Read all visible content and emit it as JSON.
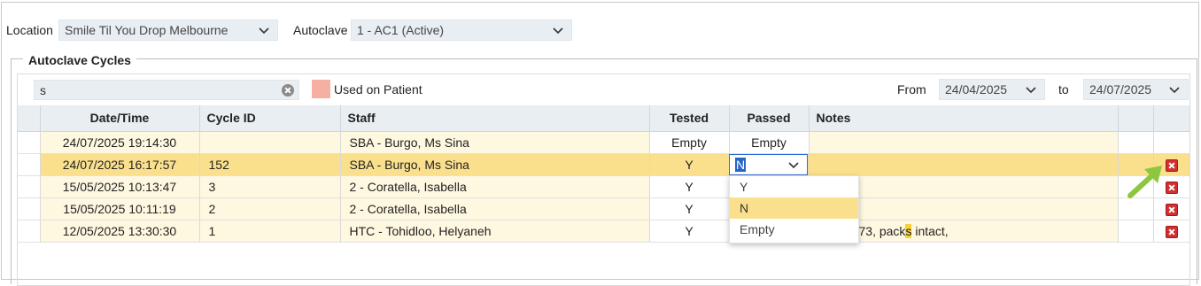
{
  "filters": {
    "location_label": "Location",
    "location_value": "Smile Til You Drop Melbourne",
    "autoclave_label": "Autoclave",
    "autoclave_value": "1 - AC1 (Active)"
  },
  "section": {
    "title": "Autoclave Cycles"
  },
  "toolbar": {
    "search_value": "s",
    "legend_label": "Used on Patient",
    "legend_color": "#f6b0a1",
    "from_label": "From",
    "from_value": "24/04/2025",
    "to_label": "to",
    "to_value": "24/07/2025"
  },
  "table": {
    "columns": [
      "Date/Time",
      "Cycle ID",
      "Staff",
      "Tested",
      "Passed",
      "Notes"
    ],
    "rows": [
      {
        "datetime": "24/07/2025 19:14:30",
        "cycle_id": "",
        "staff": "SBA - Burgo, Ms Sina",
        "tested": "Empty",
        "passed": "Empty",
        "notes": ""
      },
      {
        "datetime": "24/07/2025 16:17:57",
        "cycle_id": "152",
        "staff": "SBA - Burgo, Ms Sina",
        "tested": "Y",
        "passed": "N",
        "notes": ""
      },
      {
        "datetime": "15/05/2025 10:13:47",
        "cycle_id": "3",
        "staff": "2 - Coratella, Isabella",
        "tested": "Y",
        "passed": "",
        "notes": ""
      },
      {
        "datetime": "15/05/2025 10:11:19",
        "cycle_id": "2",
        "staff": "2 - Coratella, Isabella",
        "tested": "Y",
        "passed": "",
        "notes": ""
      },
      {
        "datetime": "12/05/2025 13:30:30",
        "cycle_id": "1",
        "staff": "HTC - Tohidloo, Helyaneh",
        "tested": "Y",
        "passed": "",
        "notes_a": "73, pack",
        "notes_hl": "s",
        "notes_b": " intact,"
      }
    ]
  },
  "editor": {
    "value": "N",
    "options": [
      "Y",
      "N",
      "Empty"
    ],
    "active_option": "N"
  },
  "colors": {
    "selected_row": "#fae08d",
    "cream_row": "#fff8e1",
    "delete_icon": "#d32f2f",
    "arrow": "#8dc63f"
  }
}
